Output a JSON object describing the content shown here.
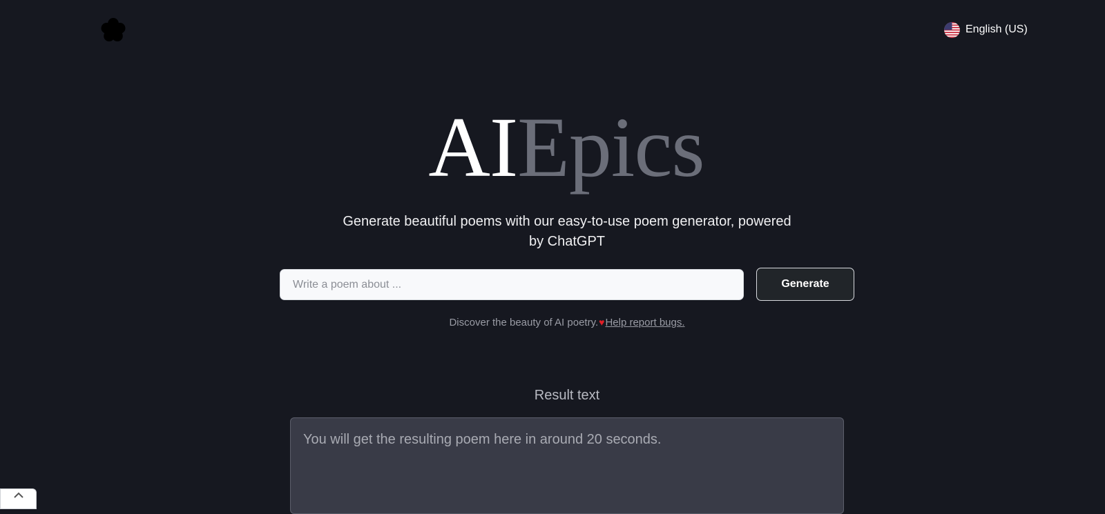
{
  "header": {
    "logo_icon": "flower-icon",
    "language": {
      "label": "English (US)",
      "flag_icon": "us-flag-icon"
    }
  },
  "hero": {
    "title_part1": "AI",
    "title_part2": "Epics",
    "subtitle_line1": "Generate beautiful poems with our easy-to-use poem generator, powered",
    "subtitle_line2": "by ChatGPT"
  },
  "prompt": {
    "placeholder": "Write a poem about ...",
    "value": "",
    "generate_label": "Generate"
  },
  "helper": {
    "text": "Discover the beauty of AI poetry.",
    "heart": "♥",
    "link_label": "Help report bugs."
  },
  "result": {
    "label": "Result text",
    "placeholder": "You will get the resulting poem here in around 20 seconds."
  },
  "colors": {
    "background": "#161820",
    "title_accent": "#6b6e79",
    "button_bg": "#212529",
    "result_bg": "#393b47",
    "heart": "#e21e26"
  },
  "scroll_top_icon": "chevron-up-icon"
}
